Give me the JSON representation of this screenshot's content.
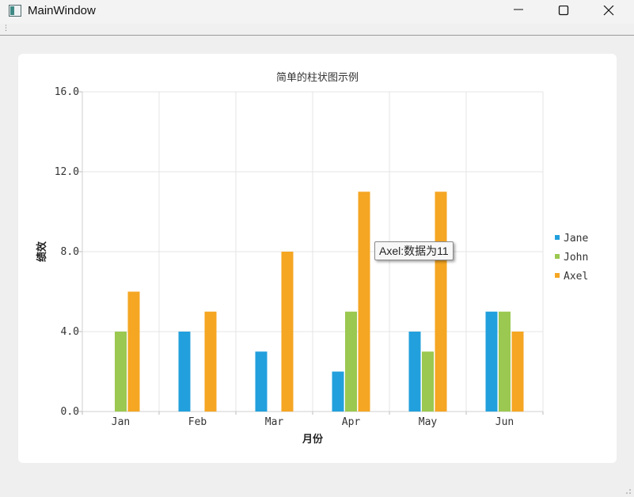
{
  "window": {
    "title": "MainWindow",
    "icon": "app-window-icon",
    "controls": [
      "minimize-icon",
      "maximize-icon",
      "close-icon"
    ]
  },
  "tooltip": {
    "text": "Axel:数据为11"
  },
  "chart_data": {
    "type": "bar",
    "title": "简单的柱状图示例",
    "xlabel": "月份",
    "ylabel": "绩效",
    "categories": [
      "Jan",
      "Feb",
      "Mar",
      "Apr",
      "May",
      "Jun"
    ],
    "series": [
      {
        "name": "Jane",
        "values": [
          0,
          4,
          3,
          2,
          4,
          5
        ],
        "color": "#22a0dd"
      },
      {
        "name": "John",
        "values": [
          4,
          0,
          0,
          5,
          3,
          5
        ],
        "color": "#9bc850"
      },
      {
        "name": "Axel",
        "values": [
          6,
          5,
          8,
          11,
          11,
          4
        ],
        "color": "#f5a623"
      }
    ],
    "ylim": [
      0,
      16
    ],
    "yticks": [
      "0.0",
      "4.0",
      "8.0",
      "12.0",
      "16.0"
    ],
    "grid": true,
    "legend_position": "right"
  }
}
